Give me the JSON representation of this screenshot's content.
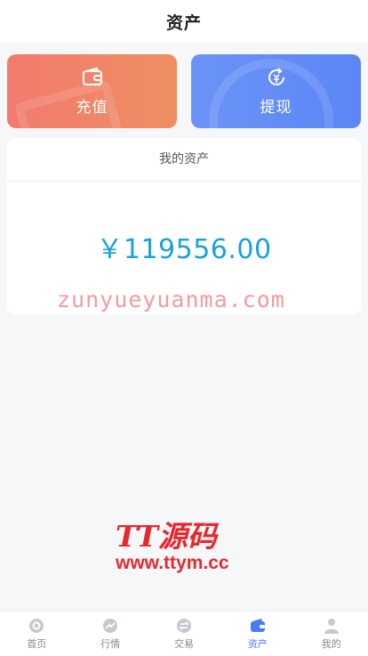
{
  "header": {
    "title": "资产"
  },
  "actions": {
    "recharge": {
      "label": "充值"
    },
    "withdraw": {
      "label": "提现"
    }
  },
  "assets": {
    "title": "我的资产",
    "amount": "￥119556.00"
  },
  "watermark": {
    "text": "zunyueyuanma.com",
    "logo_brand": "TT源码",
    "logo_url": "www.ttym.cc"
  },
  "tabbar": {
    "items": [
      {
        "label": "首页",
        "icon": "home-icon"
      },
      {
        "label": "行情",
        "icon": "market-icon"
      },
      {
        "label": "交易",
        "icon": "trade-icon"
      },
      {
        "label": "资产",
        "icon": "wallet-icon",
        "active": true
      },
      {
        "label": "我的",
        "icon": "user-icon"
      }
    ],
    "inactive_color": "#bfc3c9",
    "active_color": "#4b7bf5"
  }
}
